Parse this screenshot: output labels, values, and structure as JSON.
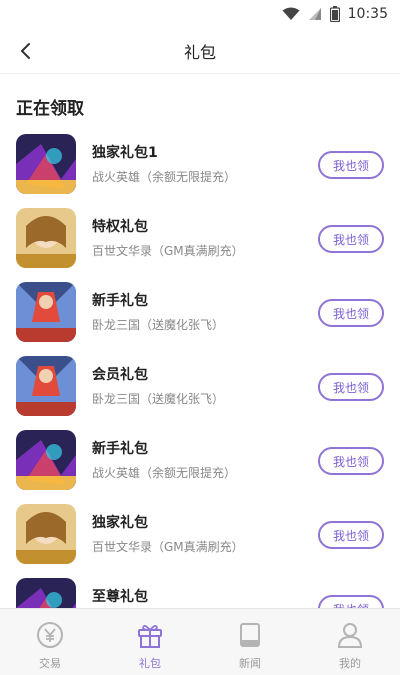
{
  "status_bar": {
    "time": "10:35"
  },
  "header": {
    "title": "礼包"
  },
  "section": {
    "title": "正在领取"
  },
  "gifts": [
    {
      "name": "独家礼包1",
      "game": "战火英雄（余额无限提充）",
      "button": "我也领",
      "icon": "game-icon-zhanhuo"
    },
    {
      "name": "特权礼包",
      "game": "百世文华录（GM真满刷充）",
      "button": "我也领",
      "icon": "game-icon-baishi"
    },
    {
      "name": "新手礼包",
      "game": "卧龙三国（送魔化张飞）",
      "button": "我也领",
      "icon": "game-icon-wolong"
    },
    {
      "name": "会员礼包",
      "game": "卧龙三国（送魔化张飞）",
      "button": "我也领",
      "icon": "game-icon-wolong"
    },
    {
      "name": "新手礼包",
      "game": "战火英雄（余额无限提充）",
      "button": "我也领",
      "icon": "game-icon-zhanhuo"
    },
    {
      "name": "独家礼包",
      "game": "百世文华录（GM真满刷充）",
      "button": "我也领",
      "icon": "game-icon-baishi"
    },
    {
      "name": "至尊礼包",
      "game": "",
      "button": "我也领",
      "icon": "game-icon-zhanhuo"
    }
  ],
  "tabs": [
    {
      "label": "交易",
      "icon": "yen-icon",
      "active": false
    },
    {
      "label": "礼包",
      "icon": "gift-icon",
      "active": true
    },
    {
      "label": "新闻",
      "icon": "book-icon",
      "active": false
    },
    {
      "label": "我的",
      "icon": "user-icon",
      "active": false
    }
  ],
  "colors": {
    "accent": "#8f74d6",
    "text": "#222222",
    "subtext": "#888888"
  }
}
